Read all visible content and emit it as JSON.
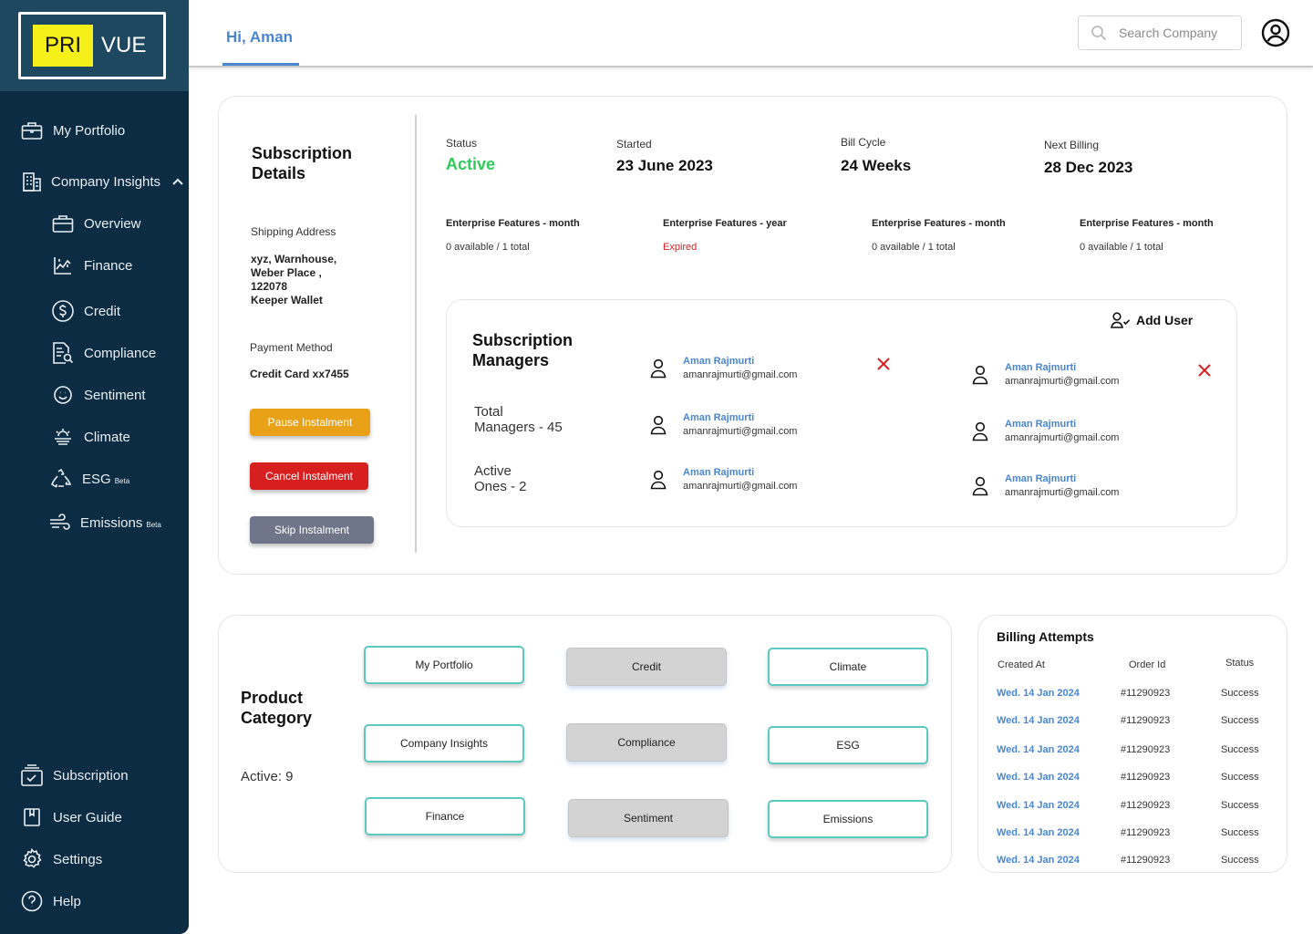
{
  "brand": {
    "part1": "PRI",
    "part2": "VUE",
    "accent": "#f5ef1a"
  },
  "sidebar": {
    "items": [
      {
        "label": "My Portfolio"
      },
      {
        "label": "Company Insights"
      },
      {
        "label": "Overview"
      },
      {
        "label": "Finance"
      },
      {
        "label": "Credit"
      },
      {
        "label": "Compliance"
      },
      {
        "label": "Sentiment"
      },
      {
        "label": "Climate"
      },
      {
        "label": "ESG",
        "badge": "Beta"
      },
      {
        "label": "Emissions",
        "badge": "Beta"
      }
    ],
    "bottom": [
      {
        "label": "Subscription"
      },
      {
        "label": "User Guide"
      },
      {
        "label": "Settings"
      },
      {
        "label": "Help"
      }
    ]
  },
  "header": {
    "greeting": "Hi, Aman",
    "search_placeholder": "Search Company"
  },
  "subscription": {
    "title_line1": "Subscription",
    "title_line2": "Details",
    "shipping_label": "Shipping Address",
    "shipping_lines": [
      "xyz, Warnhouse,",
      "Weber Place ,",
      "122078",
      "Keeper Wallet"
    ],
    "payment_label": "Payment Method",
    "payment_value": "Credit Card xx7455",
    "buttons": {
      "pause": "Pause Instalment",
      "cancel": "Cancel Instalment",
      "skip": "Skip Instalment"
    },
    "status_label": "Status",
    "status_value": "Active",
    "started_label": "Started",
    "started_value": "23 June 2023",
    "bill_cycle_label": "Bill Cycle",
    "bill_cycle_value": "24 Weeks",
    "next_billing_label": "Next Billing",
    "next_billing_value": "28 Dec 2023",
    "features": [
      {
        "title": "Enterprise Features - month",
        "sub": "0 available / 1 total"
      },
      {
        "title": "Enterprise Features - year",
        "sub": "Expired"
      },
      {
        "title": "Enterprise Features - month",
        "sub": "0 available / 1 total"
      },
      {
        "title": "Enterprise Features - month",
        "sub": "0 available / 1 total"
      }
    ],
    "colors": {
      "active": "#2ecc5a",
      "expired": "#d42222"
    }
  },
  "managers": {
    "title_line1": "Subscription",
    "title_line2": "Managers",
    "total_line1": "Total",
    "total_line2": "Managers - 45",
    "active_line1": "Active",
    "active_line2": "Ones - 2",
    "add_user": "Add User",
    "users": [
      {
        "name": "Aman Rajmurti",
        "email": "amanrajmurti@gmail.com"
      },
      {
        "name": "Aman Rajmurti",
        "email": "amanrajmurti@gmail.com"
      },
      {
        "name": "Aman Rajmurti",
        "email": "amanrajmurti@gmail.com"
      },
      {
        "name": "Aman Rajmurti",
        "email": "amanrajmurti@gmail.com"
      },
      {
        "name": "Aman Rajmurti",
        "email": "amanrajmurti@gmail.com"
      },
      {
        "name": "Aman Rajmurti",
        "email": "amanrajmurti@gmail.com"
      }
    ]
  },
  "product": {
    "title_line1": "Product",
    "title_line2": "Category",
    "active": "Active: 9",
    "chips": [
      {
        "label": "My Portfolio",
        "on": true
      },
      {
        "label": "Credit",
        "on": false
      },
      {
        "label": "Climate",
        "on": true
      },
      {
        "label": "Company Insights",
        "on": true
      },
      {
        "label": "Compliance",
        "on": false
      },
      {
        "label": "ESG",
        "on": true
      },
      {
        "label": "Finance",
        "on": true
      },
      {
        "label": "Sentiment",
        "on": false
      },
      {
        "label": "Emissions",
        "on": true
      }
    ]
  },
  "billing": {
    "title": "Billing Attempts",
    "headers": [
      "Created At",
      "Order Id",
      "Status"
    ],
    "rows": [
      {
        "date": "Wed. 14 Jan 2024",
        "order": "#11290923",
        "status": "Success"
      },
      {
        "date": "Wed. 14 Jan 2024",
        "order": "#11290923",
        "status": "Success"
      },
      {
        "date": "Wed. 14 Jan 2024",
        "order": "#11290923",
        "status": "Success"
      },
      {
        "date": "Wed. 14 Jan 2024",
        "order": "#11290923",
        "status": "Success"
      },
      {
        "date": "Wed. 14 Jan 2024",
        "order": "#11290923",
        "status": "Success"
      },
      {
        "date": "Wed. 14 Jan 2024",
        "order": "#11290923",
        "status": "Success"
      },
      {
        "date": "Wed. 14 Jan 2024",
        "order": "#11290923",
        "status": "Success"
      }
    ]
  }
}
